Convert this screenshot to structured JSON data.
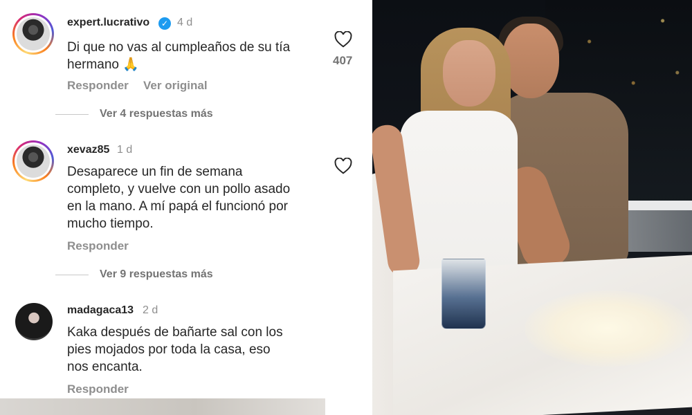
{
  "comments": [
    {
      "username": "expert.lucrativo",
      "verified": true,
      "avatar": "story-ring",
      "age": "4 d",
      "text": "Di que no vas al cumpleaños de su tía\nhermano 🙏",
      "likes": "407",
      "actions": [
        "Responder",
        "Ver original"
      ],
      "replies": "Ver 4 respuestas más"
    },
    {
      "username": "xevaz85",
      "verified": false,
      "avatar": "story-ring",
      "age": "1 d",
      "text": "Desaparece un fin de semana\ncompleto, y vuelve con un pollo asado\nen la mano. A mí papá el funcionó por\nmucho tiempo.",
      "actions": [
        "Responder"
      ],
      "replies": "Ver 9 respuestas más"
    },
    {
      "username": "madagaca13",
      "verified": false,
      "avatar": "plain",
      "age": "2 d",
      "text": "Kaka después de bañarte sal con los\npies mojados por toda la casa, eso\nnos encanta.",
      "actions": [
        "Responder"
      ]
    }
  ],
  "icons": {
    "like": "heart-outline-icon",
    "verified": "verified-badge-icon"
  },
  "colors": {
    "text": "#262626",
    "secondary": "#8e8e8e",
    "verified": "#1d9bf0"
  },
  "photo": {
    "description_tags": [
      "couple",
      "night",
      "table",
      "glass"
    ]
  }
}
